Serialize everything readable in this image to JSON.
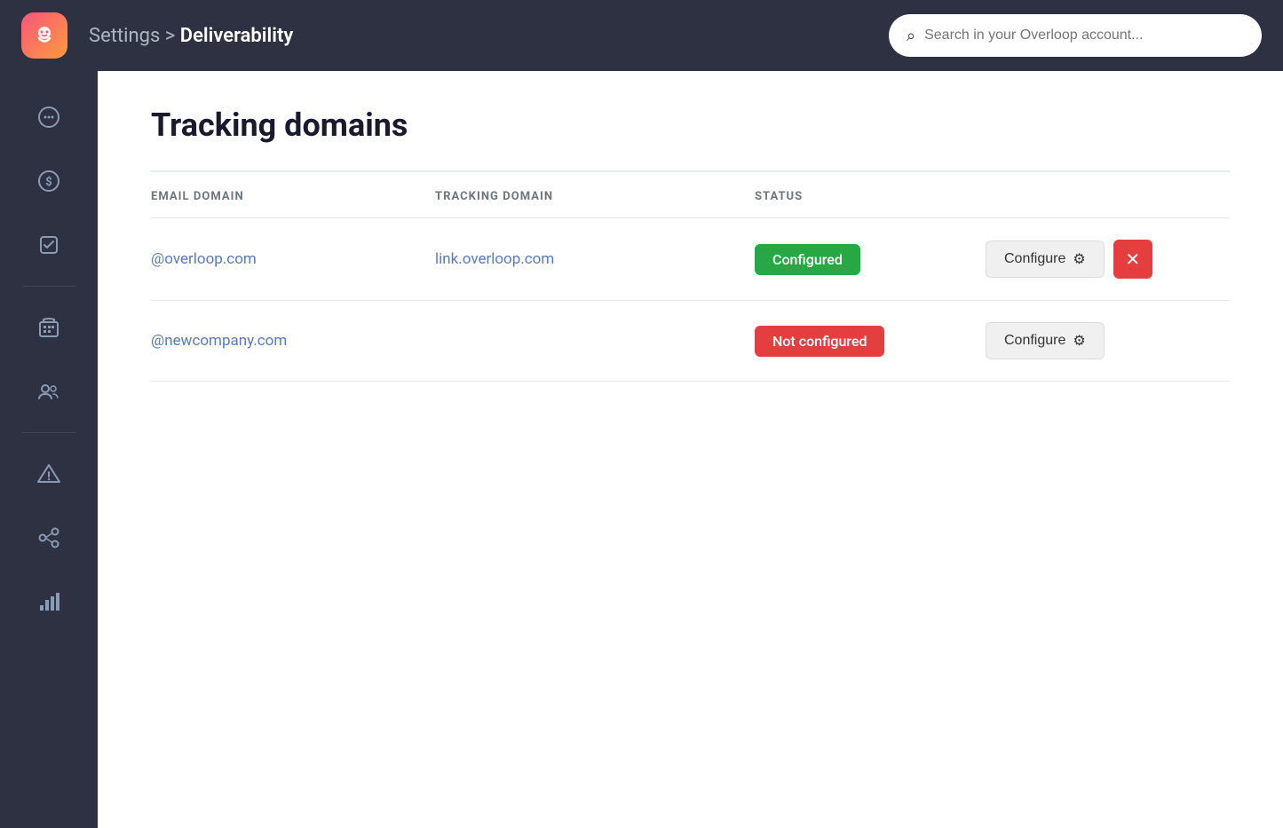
{
  "topbar": {
    "breadcrumb_prefix": "Settings > ",
    "breadcrumb_current": "Deliverability",
    "search_placeholder": "Search in your Overloop account..."
  },
  "sidebar": {
    "items": [
      {
        "name": "conversations",
        "label": "Conversations"
      },
      {
        "name": "revenue",
        "label": "Revenue"
      },
      {
        "name": "tasks",
        "label": "Tasks"
      },
      {
        "name": "company",
        "label": "Company"
      },
      {
        "name": "contacts",
        "label": "Contacts"
      },
      {
        "name": "alerts",
        "label": "Alerts"
      },
      {
        "name": "integrations",
        "label": "Integrations"
      },
      {
        "name": "analytics",
        "label": "Analytics"
      }
    ]
  },
  "main": {
    "page_title": "Tracking domains",
    "table": {
      "columns": [
        "EMAIL DOMAIN",
        "TRACKING DOMAIN",
        "STATUS",
        ""
      ],
      "rows": [
        {
          "email_domain": "@overloop.com",
          "tracking_domain": "link.overloop.com",
          "status": "Configured",
          "status_type": "configured",
          "has_delete": true
        },
        {
          "email_domain": "@newcompany.com",
          "tracking_domain": "",
          "status": "Not configured",
          "status_type": "not-configured",
          "has_delete": false
        }
      ],
      "configure_label": "Configure"
    }
  }
}
